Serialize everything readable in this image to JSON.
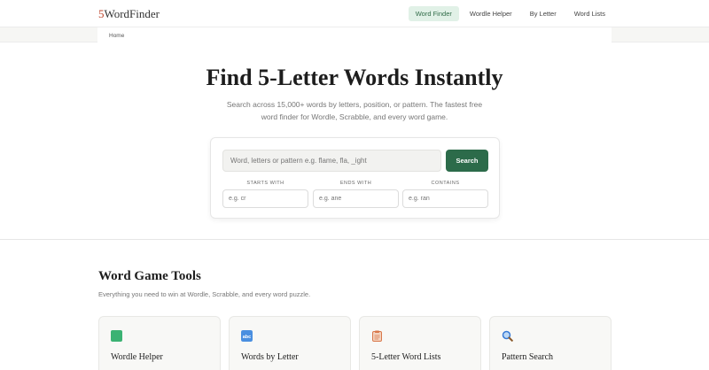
{
  "nav": {
    "logo_num": "5",
    "logo_word": "WordFinder",
    "links": [
      {
        "label": "Word Finder",
        "active": true
      },
      {
        "label": "Wordle Helper",
        "active": false
      },
      {
        "label": "By Letter",
        "active": false
      },
      {
        "label": "Word Lists",
        "active": false
      }
    ]
  },
  "breadcrumb": {
    "home": "Home"
  },
  "hero": {
    "title": "Find 5-Letter Words Instantly",
    "subtitle": "Search across 15,000+ words by letters, position, or pattern. The fastest free word finder for Wordle, Scrabble, and every word game."
  },
  "search": {
    "placeholder": "Word, letters or pattern e.g. flame, fla, _ight",
    "button": "Search",
    "filters": [
      {
        "label": "STARTS WITH",
        "placeholder": "e.g. cr"
      },
      {
        "label": "ENDS WITH",
        "placeholder": "e.g. ane"
      },
      {
        "label": "CONTAINS",
        "placeholder": "e.g. ran"
      }
    ]
  },
  "tools": {
    "title": "Word Game Tools",
    "subtitle": "Everything you need to win at Wordle, Scrabble, and every word puzzle.",
    "cards": [
      {
        "name": "Wordle Helper",
        "icon": "green-square-icon",
        "color": "#3bb273"
      },
      {
        "name": "Words by Letter",
        "icon": "abc-icon",
        "color": "#4a8fe0"
      },
      {
        "name": "5-Letter Word Lists",
        "icon": "clipboard-icon",
        "color": "#e0875a"
      },
      {
        "name": "Pattern Search",
        "icon": "magnifier-icon",
        "color": "#3a7bd5"
      }
    ]
  },
  "colors": {
    "accent": "#2c6b4a",
    "logo_num": "#c0482f",
    "active_nav_bg": "#e1f1e7"
  }
}
